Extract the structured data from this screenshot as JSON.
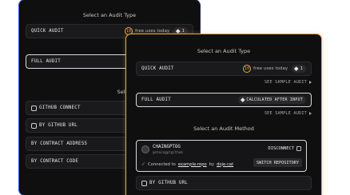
{
  "back": {
    "audit_type_heading": "Select an Audit Type",
    "quick_audit": {
      "label": "QUICK AUDIT",
      "uses_count": "10",
      "uses_text": "free uses today",
      "cost": "1"
    },
    "full_audit": {
      "label": "FULL AUDIT"
    },
    "audit_method_heading": "Select an Audit Me",
    "methods": [
      {
        "label": "GITHUB CONNECT"
      },
      {
        "label": "BY GITHUB URL"
      },
      {
        "label": "BY CONTRACT ADDRESS"
      },
      {
        "label": "BY CONTRACT CODE"
      }
    ]
  },
  "front": {
    "audit_type_heading": "Select an Audit Type",
    "quick_audit": {
      "label": "QUICK AUDIT",
      "uses_count": "10",
      "uses_text": "free uses today",
      "cost": "1"
    },
    "see_sample_1": "SEE SAMPLE AUDIT",
    "full_audit": {
      "label": "FULL AUDIT",
      "cost": "CALCULATED AFTER INPUT"
    },
    "see_sample_2": "SEE SAMPLE AUDIT",
    "audit_method_heading": "Select an Audit Method",
    "github": {
      "name": "CHAINGPTOG",
      "handle": "@chaingptgithub",
      "disconnect": "DISCONNECT",
      "connected_prefix": "Connected to",
      "repo": "example-repo",
      "by": "by",
      "user": "doje-cat",
      "switch": "SWITCH REPOSITORY"
    },
    "by_github_url": "BY GITHUB URL"
  },
  "colors": {
    "accent": "#f0a63a",
    "back_border": "#2a5ce6",
    "success": "#3fd07a"
  }
}
